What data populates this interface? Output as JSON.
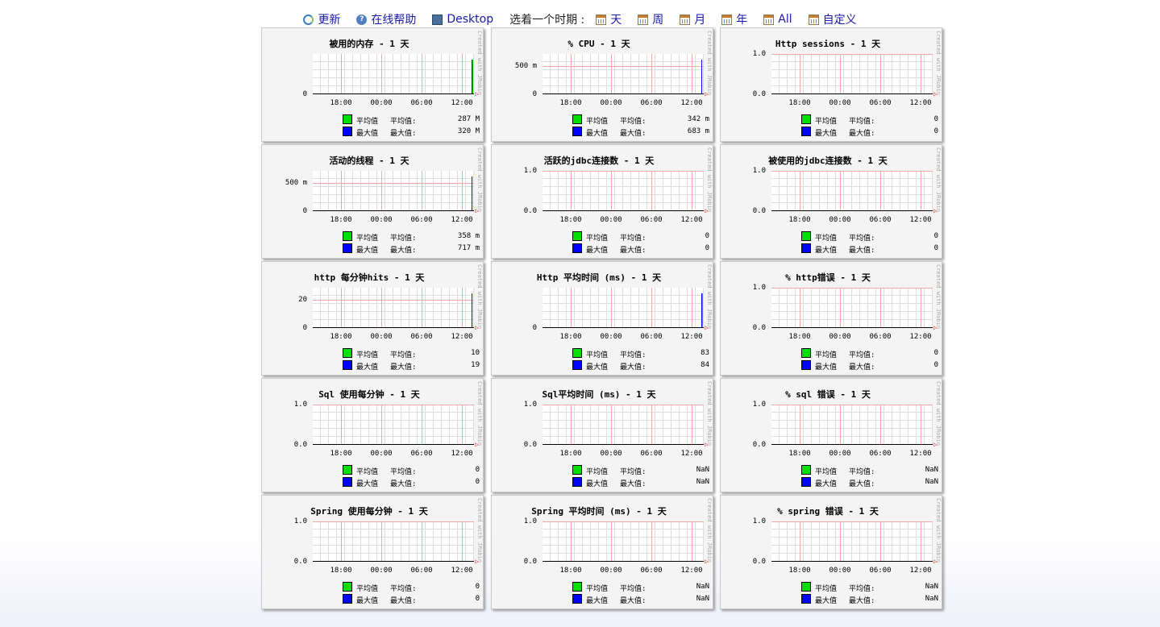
{
  "toolbar": {
    "refresh": "更新",
    "help": "在线帮助",
    "desktop": "Desktop",
    "choose_period": "选着一个时期 :",
    "periods": [
      "天",
      "周",
      "月",
      "年",
      "All",
      "自定义"
    ]
  },
  "legend_labels": {
    "avg_name": "平均值",
    "avg_label": "平均值:",
    "max_name": "最大值",
    "max_label": "最大值:"
  },
  "x_ticks": [
    "18:00",
    "00:00",
    "06:00",
    "12:00"
  ],
  "credit": "Created with JRobin",
  "colors": {
    "avg": "#00e000",
    "max": "#0000ff"
  },
  "chart_data": [
    {
      "type": "line",
      "title": "被用的内存 - 1 天",
      "y_ticks": [
        "0"
      ],
      "avg": "287 M",
      "max": "320 M",
      "spike": "avg"
    },
    {
      "type": "line",
      "title": "% CPU - 1 天",
      "y_ticks": [
        "0",
        "500 m"
      ],
      "avg": "342 m",
      "max": "683 m",
      "spike": "max"
    },
    {
      "type": "line",
      "title": "Http sessions - 1 天",
      "y_ticks": [
        "0.0",
        "1.0"
      ],
      "avg": "0",
      "max": "0",
      "spike": ""
    },
    {
      "type": "line",
      "title": "活动的线程 - 1 天",
      "y_ticks": [
        "0",
        "500 m"
      ],
      "avg": "358 m",
      "max": "717 m",
      "spike": "max"
    },
    {
      "type": "line",
      "title": "活跃的jdbc连接数 - 1 天",
      "y_ticks": [
        "0.0",
        "1.0"
      ],
      "avg": "0",
      "max": "0",
      "spike": ""
    },
    {
      "type": "line",
      "title": "被使用的jdbc连接数 - 1 天",
      "y_ticks": [
        "0.0",
        "1.0"
      ],
      "avg": "0",
      "max": "0",
      "spike": ""
    },
    {
      "type": "line",
      "title": "http 每分钟hits - 1 天",
      "y_ticks": [
        "0",
        "20"
      ],
      "avg": "10",
      "max": "19",
      "spike": "max"
    },
    {
      "type": "line",
      "title": "Http 平均时间 (ms) - 1 天",
      "y_ticks": [
        "0"
      ],
      "avg": "83",
      "max": "84",
      "spike": "avg"
    },
    {
      "type": "line",
      "title": "% http错误 - 1 天",
      "y_ticks": [
        "0.0",
        "1.0"
      ],
      "avg": "0",
      "max": "0",
      "spike": ""
    },
    {
      "type": "line",
      "title": "Sql 使用每分钟 - 1 天",
      "y_ticks": [
        "0.0",
        "1.0"
      ],
      "avg": "0",
      "max": "0",
      "spike": ""
    },
    {
      "type": "line",
      "title": "Sql平均时间 (ms) - 1 天",
      "y_ticks": [
        "0.0",
        "1.0"
      ],
      "avg": "NaN",
      "max": "NaN",
      "spike": ""
    },
    {
      "type": "line",
      "title": "% sql 错误 - 1 天",
      "y_ticks": [
        "0.0",
        "1.0"
      ],
      "avg": "NaN",
      "max": "NaN",
      "spike": ""
    },
    {
      "type": "line",
      "title": "Spring 使用每分钟 - 1 天",
      "y_ticks": [
        "0.0",
        "1.0"
      ],
      "avg": "0",
      "max": "0",
      "spike": ""
    },
    {
      "type": "line",
      "title": "Spring 平均时间 (ms) - 1 天",
      "y_ticks": [
        "0.0",
        "1.0"
      ],
      "avg": "NaN",
      "max": "NaN",
      "spike": ""
    },
    {
      "type": "line",
      "title": "% spring 错误 - 1 天",
      "y_ticks": [
        "0.0",
        "1.0"
      ],
      "avg": "NaN",
      "max": "NaN",
      "spike": ""
    }
  ]
}
